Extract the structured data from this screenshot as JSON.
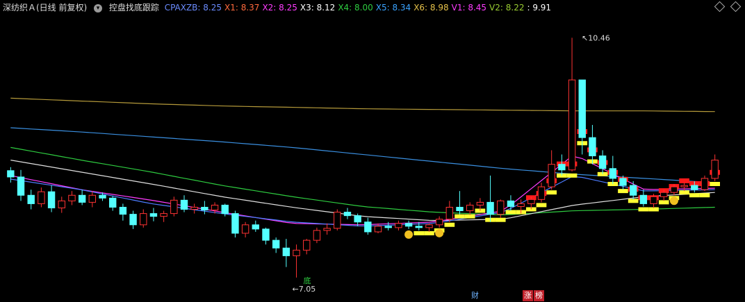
{
  "header": {
    "title": "深纺织Ａ(日线 前复权)",
    "mode_icon": "chevron-down-icon",
    "indicator_name": "控盘找底跟踪",
    "values": [
      {
        "label": "CPAXZB",
        "value": "8.25",
        "color": "#6b8cff"
      },
      {
        "label": "X1",
        "value": "8.37",
        "color": "#ff6a3d"
      },
      {
        "label": "X2",
        "value": "8.25",
        "color": "#ff3cff"
      },
      {
        "label": "X3",
        "value": "8.12",
        "color": "#ffffff"
      },
      {
        "label": "X4",
        "value": "8.00",
        "color": "#2ecc40"
      },
      {
        "label": "X5",
        "value": "8.34",
        "color": "#3aa3ff"
      },
      {
        "label": "X6",
        "value": "8.98",
        "color": "#e6c24a"
      },
      {
        "label": "V1",
        "value": "8.45",
        "color": "#ff3cff"
      },
      {
        "label": "V2",
        "value": "8.22",
        "color": "#9acd32"
      },
      {
        "label": "",
        "value": "9.91",
        "color": "#ffffff"
      }
    ]
  },
  "annotations": {
    "high_label": "10.46",
    "low_label": "7.05",
    "bottom_marker": "底",
    "badges": [
      "财",
      "涨",
      "榜"
    ]
  },
  "chart_data": {
    "type": "candlestick",
    "ylim": [
      6.9,
      10.7
    ],
    "high": 10.46,
    "low": 7.05,
    "grid": false,
    "candles": [
      {
        "o": 8.57,
        "h": 8.62,
        "l": 8.4,
        "c": 8.48
      },
      {
        "o": 8.48,
        "h": 8.58,
        "l": 8.14,
        "c": 8.22
      },
      {
        "o": 8.22,
        "h": 8.3,
        "l": 8.02,
        "c": 8.1
      },
      {
        "o": 8.1,
        "h": 8.33,
        "l": 8.05,
        "c": 8.27
      },
      {
        "o": 8.27,
        "h": 8.36,
        "l": 7.98,
        "c": 8.04
      },
      {
        "o": 8.04,
        "h": 8.2,
        "l": 7.97,
        "c": 8.14
      },
      {
        "o": 8.14,
        "h": 8.28,
        "l": 8.08,
        "c": 8.22
      },
      {
        "o": 8.22,
        "h": 8.3,
        "l": 8.08,
        "c": 8.12
      },
      {
        "o": 8.12,
        "h": 8.28,
        "l": 8.05,
        "c": 8.22
      },
      {
        "o": 8.22,
        "h": 8.26,
        "l": 8.14,
        "c": 8.18
      },
      {
        "o": 8.18,
        "h": 8.21,
        "l": 8.0,
        "c": 8.05
      },
      {
        "o": 8.05,
        "h": 8.1,
        "l": 7.86,
        "c": 7.95
      },
      {
        "o": 7.95,
        "h": 8.0,
        "l": 7.74,
        "c": 7.8
      },
      {
        "o": 7.8,
        "h": 8.02,
        "l": 7.76,
        "c": 7.96
      },
      {
        "o": 7.96,
        "h": 8.04,
        "l": 7.85,
        "c": 7.92
      },
      {
        "o": 7.92,
        "h": 8.0,
        "l": 7.84,
        "c": 7.96
      },
      {
        "o": 7.96,
        "h": 8.2,
        "l": 7.92,
        "c": 8.15
      },
      {
        "o": 8.15,
        "h": 8.22,
        "l": 7.98,
        "c": 8.02
      },
      {
        "o": 8.02,
        "h": 8.1,
        "l": 7.96,
        "c": 8.05
      },
      {
        "o": 8.05,
        "h": 8.14,
        "l": 7.95,
        "c": 8.01
      },
      {
        "o": 8.01,
        "h": 8.12,
        "l": 7.96,
        "c": 8.08
      },
      {
        "o": 8.08,
        "h": 8.1,
        "l": 7.92,
        "c": 7.96
      },
      {
        "o": 7.96,
        "h": 8.0,
        "l": 7.62,
        "c": 7.68
      },
      {
        "o": 7.68,
        "h": 7.84,
        "l": 7.62,
        "c": 7.8
      },
      {
        "o": 7.8,
        "h": 7.86,
        "l": 7.7,
        "c": 7.74
      },
      {
        "o": 7.74,
        "h": 7.76,
        "l": 7.52,
        "c": 7.58
      },
      {
        "o": 7.58,
        "h": 7.62,
        "l": 7.4,
        "c": 7.47
      },
      {
        "o": 7.47,
        "h": 7.6,
        "l": 7.2,
        "c": 7.36
      },
      {
        "o": 7.36,
        "h": 7.52,
        "l": 7.05,
        "c": 7.44
      },
      {
        "o": 7.44,
        "h": 7.6,
        "l": 7.38,
        "c": 7.58
      },
      {
        "o": 7.58,
        "h": 7.76,
        "l": 7.54,
        "c": 7.72
      },
      {
        "o": 7.72,
        "h": 7.82,
        "l": 7.66,
        "c": 7.75
      },
      {
        "o": 7.75,
        "h": 8.02,
        "l": 7.72,
        "c": 7.98
      },
      {
        "o": 7.98,
        "h": 8.04,
        "l": 7.88,
        "c": 7.93
      },
      {
        "o": 7.93,
        "h": 7.96,
        "l": 7.78,
        "c": 7.84
      },
      {
        "o": 7.84,
        "h": 7.9,
        "l": 7.66,
        "c": 7.7
      },
      {
        "o": 7.7,
        "h": 7.82,
        "l": 7.68,
        "c": 7.78
      },
      {
        "o": 7.78,
        "h": 7.84,
        "l": 7.72,
        "c": 7.76
      },
      {
        "o": 7.76,
        "h": 7.86,
        "l": 7.72,
        "c": 7.82
      },
      {
        "o": 7.82,
        "h": 7.86,
        "l": 7.74,
        "c": 7.78
      },
      {
        "o": 7.78,
        "h": 7.84,
        "l": 7.72,
        "c": 7.76
      },
      {
        "o": 7.76,
        "h": 7.82,
        "l": 7.7,
        "c": 7.8
      },
      {
        "o": 7.8,
        "h": 7.92,
        "l": 7.76,
        "c": 7.88
      },
      {
        "o": 7.88,
        "h": 8.14,
        "l": 7.84,
        "c": 8.05
      },
      {
        "o": 8.05,
        "h": 8.28,
        "l": 7.95,
        "c": 8.0
      },
      {
        "o": 8.0,
        "h": 8.12,
        "l": 7.94,
        "c": 8.08
      },
      {
        "o": 8.08,
        "h": 8.18,
        "l": 8.0,
        "c": 8.12
      },
      {
        "o": 8.12,
        "h": 8.5,
        "l": 7.84,
        "c": 7.95
      },
      {
        "o": 7.95,
        "h": 8.16,
        "l": 7.9,
        "c": 8.14
      },
      {
        "o": 8.14,
        "h": 8.22,
        "l": 8.0,
        "c": 8.06
      },
      {
        "o": 8.06,
        "h": 8.16,
        "l": 7.96,
        "c": 8.1
      },
      {
        "o": 8.1,
        "h": 8.2,
        "l": 8.02,
        "c": 8.16
      },
      {
        "o": 8.16,
        "h": 8.4,
        "l": 8.12,
        "c": 8.34
      },
      {
        "o": 8.34,
        "h": 8.86,
        "l": 8.3,
        "c": 8.66
      },
      {
        "o": 8.66,
        "h": 8.8,
        "l": 8.5,
        "c": 8.58
      },
      {
        "o": 8.58,
        "h": 10.46,
        "l": 8.56,
        "c": 9.86
      },
      {
        "o": 9.86,
        "h": 9.48,
        "l": 8.8,
        "c": 9.04
      },
      {
        "o": 9.04,
        "h": 9.22,
        "l": 8.66,
        "c": 8.78
      },
      {
        "o": 8.78,
        "h": 8.86,
        "l": 8.52,
        "c": 8.6
      },
      {
        "o": 8.6,
        "h": 8.78,
        "l": 8.38,
        "c": 8.46
      },
      {
        "o": 8.46,
        "h": 8.5,
        "l": 8.3,
        "c": 8.36
      },
      {
        "o": 8.36,
        "h": 8.42,
        "l": 8.16,
        "c": 8.22
      },
      {
        "o": 8.22,
        "h": 8.3,
        "l": 8.06,
        "c": 8.1
      },
      {
        "o": 8.1,
        "h": 8.24,
        "l": 8.04,
        "c": 8.2
      },
      {
        "o": 8.2,
        "h": 8.3,
        "l": 8.14,
        "c": 8.26
      },
      {
        "o": 8.26,
        "h": 8.38,
        "l": 8.22,
        "c": 8.34
      },
      {
        "o": 8.34,
        "h": 8.4,
        "l": 8.28,
        "c": 8.36
      },
      {
        "o": 8.36,
        "h": 8.42,
        "l": 8.26,
        "c": 8.3
      },
      {
        "o": 8.3,
        "h": 8.5,
        "l": 8.28,
        "c": 8.46
      },
      {
        "o": 8.46,
        "h": 8.8,
        "l": 8.42,
        "c": 8.72
      }
    ],
    "lines": [
      {
        "label": "X6",
        "color": "#b59a3a",
        "values": [
          9.6,
          9.56,
          9.52,
          9.49,
          9.47,
          9.45,
          9.44,
          9.43,
          9.42,
          9.42,
          9.41
        ]
      },
      {
        "label": "X5",
        "color": "#3a8fe0",
        "values": [
          9.18,
          9.12,
          9.05,
          8.98,
          8.9,
          8.8,
          8.7,
          8.6,
          8.52,
          8.46,
          8.4
        ]
      },
      {
        "label": "X4",
        "color": "#2ecc40",
        "values": [
          8.9,
          8.72,
          8.55,
          8.36,
          8.2,
          8.06,
          7.98,
          7.94,
          8.0,
          8.02,
          8.05
        ]
      },
      {
        "label": "X3",
        "color": "#e0e0e0",
        "values": [
          8.72,
          8.55,
          8.38,
          8.2,
          8.05,
          7.92,
          7.86,
          7.88,
          8.08,
          8.2,
          8.26
        ]
      },
      {
        "label": "V1",
        "color": "#ff3cff",
        "values": [
          8.5,
          8.3,
          8.15,
          7.98,
          7.82,
          7.8,
          7.84,
          8.0,
          8.8,
          8.3,
          8.32
        ]
      },
      {
        "label": "CPAXZB",
        "color": "#4c7cff",
        "values": [
          8.45,
          8.3,
          8.1,
          7.96,
          7.84,
          7.78,
          7.82,
          7.98,
          8.5,
          8.28,
          8.3
        ]
      }
    ],
    "markers": {
      "smiley_count": 4
    }
  }
}
